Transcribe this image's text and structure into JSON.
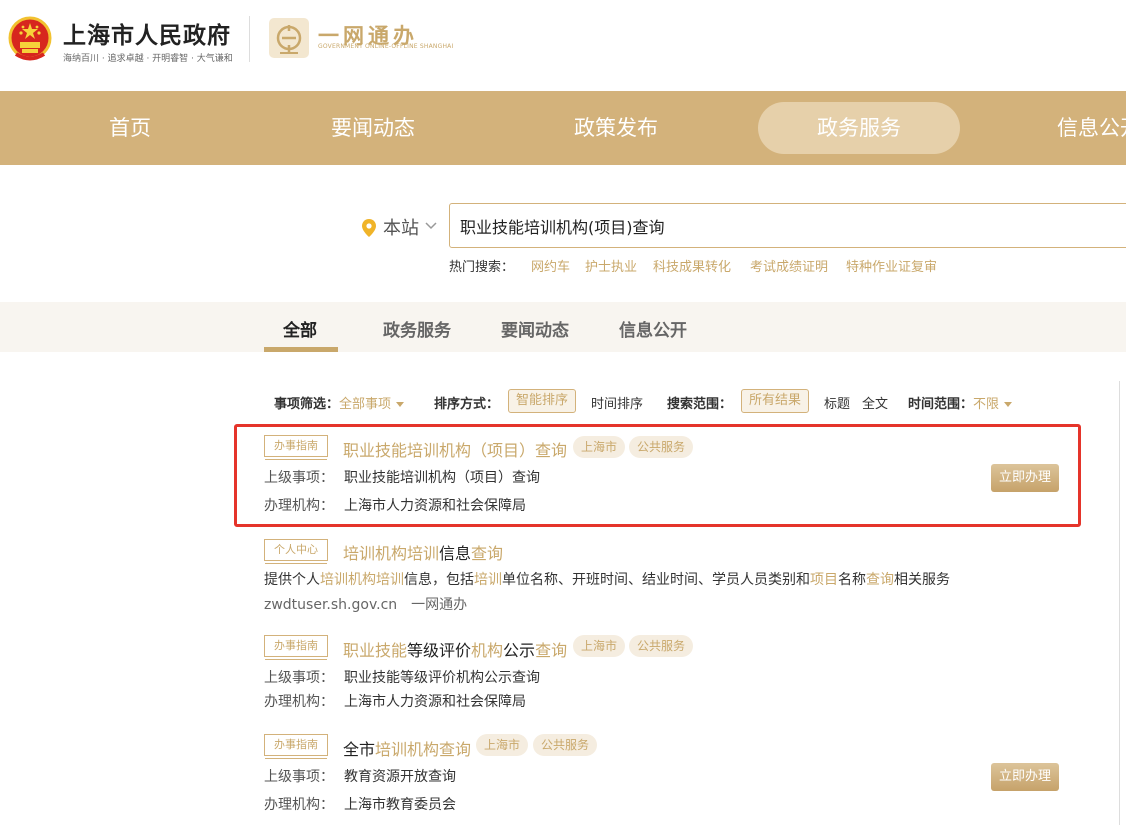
{
  "header": {
    "site_title": "上海市人民政府",
    "site_subtitle": "海纳百川 · 追求卓越 · 开明睿智 · 大气谦和",
    "yiwang_title": "一网通办",
    "yiwang_subtitle": "GOVERNMENT ONLINE-OFFLINE SHANGHAI"
  },
  "nav": {
    "items": [
      "首页",
      "要闻动态",
      "政策发布",
      "政务服务",
      "信息公开"
    ],
    "active": "政务服务"
  },
  "search": {
    "scope": "本站",
    "query": "职业技能培训机构(项目)查询",
    "hot_label": "热门搜索：",
    "hot_links": [
      "网约车",
      "护士执业",
      "科技成果转化",
      "考试成绩证明",
      "特种作业证复审"
    ]
  },
  "tabs": {
    "items": [
      "全部",
      "政务服务",
      "要闻动态",
      "信息公开"
    ],
    "active": "全部"
  },
  "filters": {
    "item_filter_label": "事项筛选：",
    "item_filter_value": "全部事项",
    "sort_label": "排序方式：",
    "sort_options": [
      "智能排序",
      "时间排序"
    ],
    "scope_label": "搜索范围：",
    "scope_options": [
      "所有结果",
      "标题",
      "全文"
    ],
    "time_label": "时间范围：",
    "time_value": "不限"
  },
  "results": [
    {
      "tag": "办事指南",
      "title_parts": [
        {
          "t": "职业技能培训机构（项目）查询",
          "hl": true
        }
      ],
      "chips": [
        "上海市",
        "公共服务"
      ],
      "meta": [
        {
          "k": "上级事项：",
          "v": "职业技能培训机构（项目）查询"
        },
        {
          "k": "办理机构：",
          "v": "上海市人力资源和社会保障局"
        }
      ],
      "action": "立即办理"
    },
    {
      "tag": "个人中心",
      "title_parts": [
        {
          "t": "培训机构培训",
          "hl": true
        },
        {
          "t": "信息",
          "hl": false
        },
        {
          "t": "查询",
          "hl": true
        }
      ],
      "desc_parts": [
        {
          "t": "提供个人",
          "hl": false
        },
        {
          "t": "培训机构培训",
          "hl": true
        },
        {
          "t": "信息，包括",
          "hl": false
        },
        {
          "t": "培训",
          "hl": true
        },
        {
          "t": "单位名称、开班时间、结业时间、学员人员类别和",
          "hl": false
        },
        {
          "t": "项目",
          "hl": true
        },
        {
          "t": "名称",
          "hl": false
        },
        {
          "t": "查询",
          "hl": true
        },
        {
          "t": "相关服务",
          "hl": false
        }
      ],
      "source_url": "zwdtuser.sh.gov.cn",
      "source_name": "一网通办"
    },
    {
      "tag": "办事指南",
      "title_parts": [
        {
          "t": "职业技能",
          "hl": true
        },
        {
          "t": "等级评价",
          "hl": false
        },
        {
          "t": "机构",
          "hl": true
        },
        {
          "t": "公示",
          "hl": false
        },
        {
          "t": "查询",
          "hl": true
        }
      ],
      "chips": [
        "上海市",
        "公共服务"
      ],
      "meta": [
        {
          "k": "上级事项：",
          "v": "职业技能等级评价机构公示查询"
        },
        {
          "k": "办理机构：",
          "v": "上海市人力资源和社会保障局"
        }
      ]
    },
    {
      "tag": "办事指南",
      "title_parts": [
        {
          "t": "全市",
          "hl": false
        },
        {
          "t": "培训机构查询",
          "hl": true
        }
      ],
      "chips": [
        "上海市",
        "公共服务"
      ],
      "meta": [
        {
          "k": "上级事项：",
          "v": "教育资源开放查询"
        },
        {
          "k": "办理机构：",
          "v": "上海市教育委员会"
        }
      ],
      "action": "立即办理"
    }
  ],
  "colors": {
    "gold": "#c9a86b",
    "nav_bg": "#d3b27b",
    "highlight_border": "#e5342a"
  }
}
